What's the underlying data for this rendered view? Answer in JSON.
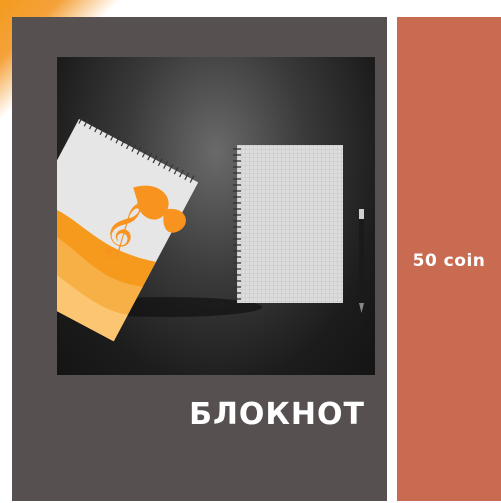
{
  "product": {
    "title": "БЛОКНОТ",
    "image_alt": "notebook-mockup",
    "colors": {
      "card_bg": "#565150",
      "price_bg": "#c96b51",
      "accent": "#f39a1e"
    }
  },
  "price": {
    "label": "50 coin"
  }
}
